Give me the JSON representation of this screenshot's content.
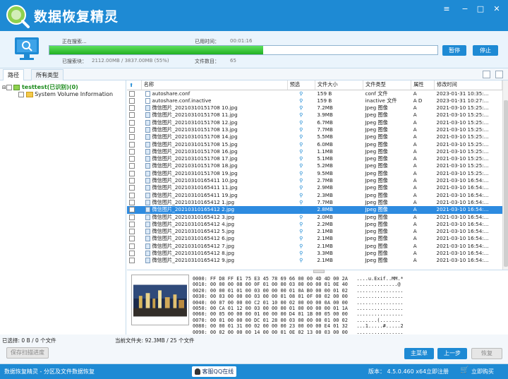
{
  "app": {
    "title": "数据恢复精灵",
    "bottom_title": "数据恢复精灵 - 分区及文件数据恢复",
    "version": "版本： 4.5.0.460 x64",
    "register": "立即注册",
    "buy": "立即购买",
    "support": "客服QQ在线"
  },
  "scan": {
    "searching_label": "正在搜索...",
    "time_label": "已用时间：",
    "time_value": "00:01:16",
    "sectors_label": "已搜索块：",
    "sectors_value": "2112.00MB / 3837.00MB (55%)",
    "files_label": "文件数目：",
    "files_value": "65",
    "progress": 0.55,
    "pause": "暂停",
    "stop": "停止"
  },
  "tabs": [
    "路径",
    "所有类型"
  ],
  "tree": {
    "root": "testtest(已识别)(0)",
    "child": "System Volume Information"
  },
  "columns": [
    "名称",
    "预选",
    "文件大小",
    "文件类型",
    "属性",
    "修改时间"
  ],
  "files": [
    {
      "name": "autoshare.conf",
      "size": "159 B",
      "type": "conf 文件",
      "attr": "A",
      "time": "2023-01-31 10:35:..."
    },
    {
      "name": "autoshare.conf.inactive",
      "size": "159 B",
      "type": "inactive 文件",
      "attr": "A D",
      "time": "2023-01-31 10:27:..."
    },
    {
      "name": "微信图片_20210310151708 10.jpg",
      "size": "7.2MB",
      "type": "Jpeg 图像",
      "attr": "A",
      "time": "2021-03-10 15:25:..."
    },
    {
      "name": "微信图片_20210310151708 11.jpg",
      "size": "3.9MB",
      "type": "Jpeg 图像",
      "attr": "A",
      "time": "2021-03-10 15:25:..."
    },
    {
      "name": "微信图片_20210310151708 12.jpg",
      "size": "6.7MB",
      "type": "Jpeg 图像",
      "attr": "A",
      "time": "2021-03-10 15:25:..."
    },
    {
      "name": "微信图片_20210310151708 13.jpg",
      "size": "7.7MB",
      "type": "Jpeg 图像",
      "attr": "A",
      "time": "2021-03-10 15:25:..."
    },
    {
      "name": "微信图片_20210310151708 14.jpg",
      "size": "5.5MB",
      "type": "Jpeg 图像",
      "attr": "A",
      "time": "2021-03-10 15:25:..."
    },
    {
      "name": "微信图片_20210310151708 15.jpg",
      "size": "6.0MB",
      "type": "Jpeg 图像",
      "attr": "A",
      "time": "2021-03-10 15:25:..."
    },
    {
      "name": "微信图片_20210310151708 16.jpg",
      "size": "1.1MB",
      "type": "Jpeg 图像",
      "attr": "A",
      "time": "2021-03-10 15:25:..."
    },
    {
      "name": "微信图片_20210310151708 17.jpg",
      "size": "5.1MB",
      "type": "Jpeg 图像",
      "attr": "A",
      "time": "2021-03-10 15:25:..."
    },
    {
      "name": "微信图片_20210310151708 18.jpg",
      "size": "5.2MB",
      "type": "Jpeg 图像",
      "attr": "A",
      "time": "2021-03-10 15:25:..."
    },
    {
      "name": "微信图片_20210310151708 19.jpg",
      "size": "9.5MB",
      "type": "Jpeg 图像",
      "attr": "A",
      "time": "2021-03-10 15:25:..."
    },
    {
      "name": "微信图片_20210310165411 10.jpg",
      "size": "2.7MB",
      "type": "Jpeg 图像",
      "attr": "A",
      "time": "2021-03-10 16:54:..."
    },
    {
      "name": "微信图片_20210310165411 11.jpg",
      "size": "2.9MB",
      "type": "Jpeg 图像",
      "attr": "A",
      "time": "2021-03-10 16:54:..."
    },
    {
      "name": "微信图片_20210310165411 19.jpg",
      "size": "2.3MB",
      "type": "Jpeg 图像",
      "attr": "A",
      "time": "2021-03-10 16:54:..."
    },
    {
      "name": "微信图片_20210310165412 1.jpg",
      "size": "7.7MB",
      "type": "Jpeg 图像",
      "attr": "A",
      "time": "2021-03-10 16:54:..."
    },
    {
      "name": "微信图片_20210310165412 2.jpg",
      "size": "2.8MB",
      "type": "Jpeg 图像",
      "attr": "A",
      "time": "2021-03-10 16:54:..."
    },
    {
      "name": "微信图片_20210310165412 3.jpg",
      "size": "2.0MB",
      "type": "Jpeg 图像",
      "attr": "A",
      "time": "2021-03-10 16:54:..."
    },
    {
      "name": "微信图片_20210310165412 4.jpg",
      "size": "2.2MB",
      "type": "Jpeg 图像",
      "attr": "A",
      "time": "2021-03-10 16:54:..."
    },
    {
      "name": "微信图片_20210310165412 5.jpg",
      "size": "2.1MB",
      "type": "Jpeg 图像",
      "attr": "A",
      "time": "2021-03-10 16:54:..."
    },
    {
      "name": "微信图片_20210310165412 6.jpg",
      "size": "2.1MB",
      "type": "Jpeg 图像",
      "attr": "A",
      "time": "2021-03-10 16:54:..."
    },
    {
      "name": "微信图片_20210310165412 7.jpg",
      "size": "2.1MB",
      "type": "Jpeg 图像",
      "attr": "A",
      "time": "2021-03-10 16:54:..."
    },
    {
      "name": "微信图片_20210310165412 8.jpg",
      "size": "3.3MB",
      "type": "Jpeg 图像",
      "attr": "A",
      "time": "2021-03-10 16:54:..."
    },
    {
      "name": "微信图片_20210310165412 9.jpg",
      "size": "2.1MB",
      "type": "Jpeg 图像",
      "attr": "A",
      "time": "2021-03-10 16:54:..."
    }
  ],
  "selected_row": 16,
  "hex": [
    "0000: FF D8 FF E1 75 E3 45 78 69 66 00 00 4D 4D 00 2A   ....u.Exif..MM.*",
    "0010: 00 00 00 08 00 0F 01 00 00 03 00 00 00 01 0E 40   ..............@",
    "0020: 00 00 01 01 00 03 00 00 00 01 0A B0 00 00 01 02   ................",
    "0030: 00 03 00 00 00 03 00 00 01 08 01 0F 00 02 00 00   ................",
    "0040: 00 07 00 00 00 C2 01 10 00 02 00 00 00 0A 00 00   ................",
    "0050: 00 CA 01 12 00 03 00 00 00 01 00 00 00 00 01 1A   ................",
    "0060: 00 05 00 00 00 01 00 00 00 D4 01 1B 00 05 00 00   ................",
    "0070: 00 01 00 00 00 DC 01 28 00 03 00 00 00 01 00 02   .......(.......",
    "0080: 00 00 01 31 00 02 00 00 00 23 00 00 00 E4 01 32   ...1.....#.....2",
    "0090: 00 02 00 00 00 14 00 00 01 0E 02 13 00 03 00 00   ................"
  ],
  "status": {
    "selected": "已选择: 0 B / 0 个文件",
    "current_folder": "当前文件夹: 92.3MB / 25 个文件"
  },
  "buttons": {
    "save_scan": "保存扫描进度",
    "main_menu": "主菜单",
    "back": "上一步",
    "recover": "恢复"
  }
}
